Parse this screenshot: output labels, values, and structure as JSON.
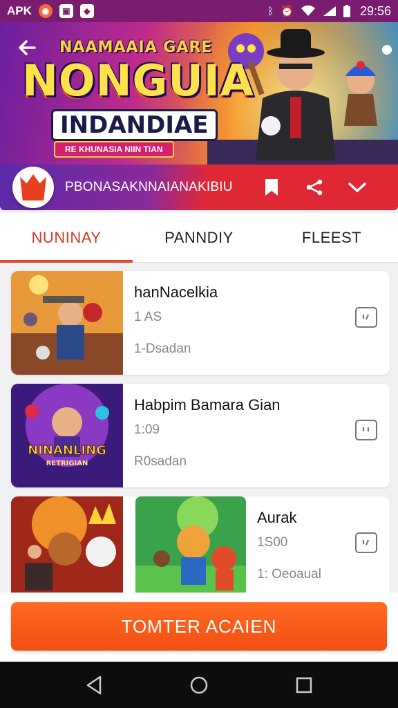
{
  "status_bar": {
    "app_label": "APK",
    "time": "29:56",
    "icons": [
      "notification-app-icon",
      "image-icon",
      "photo-icon",
      "bluetooth-icon",
      "alarm-icon",
      "wifi-icon",
      "signal-icon",
      "battery-icon"
    ]
  },
  "hero": {
    "logo_top": "NAAMAAIA GARE",
    "logo_main": "NONGUIA",
    "logo_sub": "INDANDIAE",
    "logo_ribbon": "RE KHUNASIA NIIN TIAN"
  },
  "info_bar": {
    "title": "PBONASAKNNAIANAKIBIU"
  },
  "tabs": [
    {
      "label": "NUNINAY",
      "active": true
    },
    {
      "label": "PANNDIY",
      "active": false
    },
    {
      "label": "FLEEST",
      "active": false
    }
  ],
  "items": [
    {
      "title": "hanNacelkia",
      "meta": "1 AS",
      "sub": "1-Dsadan"
    },
    {
      "title": "Habpim Bamara Gian",
      "meta": "1:09",
      "sub": "R0sadan"
    },
    {
      "title": "Aurak",
      "meta": "1S00",
      "sub": "1: Oeoaual"
    }
  ],
  "thumbs": {
    "item2_title": "NINANLING",
    "item2_sub": "RETRIGIAN"
  },
  "cta": {
    "label": "TOMTER ACAIEN"
  },
  "colors": {
    "accent": "#e24a2f",
    "cta": "#f5561a",
    "status_bar": "#7a1d6e",
    "nav_bar": "#0d0d0d"
  }
}
